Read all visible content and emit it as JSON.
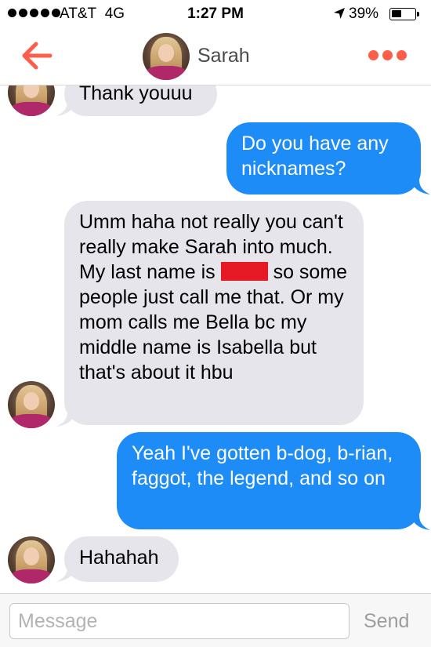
{
  "status_bar": {
    "carrier": "AT&T",
    "network": "4G",
    "time": "1:27 PM",
    "battery": "39%"
  },
  "header": {
    "back_icon": "back-arrow-icon",
    "contact_name": "Sarah",
    "more_icon": "more-dots-icon",
    "accent_color": "#fd5d49"
  },
  "messages": [
    {
      "from": "Sarah",
      "text": "Thank youuu"
    },
    {
      "from": "me",
      "text": "Do you have any nicknames?"
    },
    {
      "from": "Sarah",
      "text_before_redaction": "Umm haha not really you can't really make Sarah into much. My last name is",
      "text_after_redaction": "so some people just call me that. Or my mom calls me Bella bc my middle name is Isabella but that's about it hbu"
    },
    {
      "from": "me",
      "text": "Yeah I've gotten b-dog, b-rian, faggot, the legend, and so on"
    },
    {
      "from": "Sarah",
      "text": "Hahahah"
    }
  ],
  "colors": {
    "incoming_bubble": "#e6e5eb",
    "outgoing_bubble": "#1e8cf6",
    "redaction": "#e61a24"
  },
  "composer": {
    "placeholder": "Message",
    "value": "",
    "send_label": "Send"
  }
}
